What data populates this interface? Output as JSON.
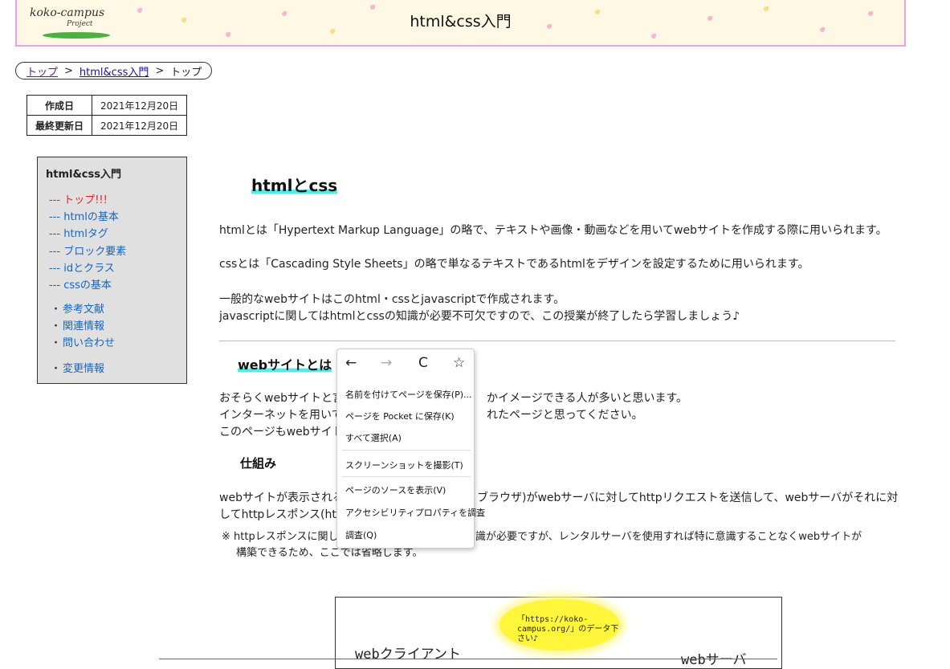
{
  "header": {
    "logo_line1": "koko-campus",
    "logo_line2": "Project",
    "title": "html&css入門"
  },
  "breadcrumb": {
    "items": [
      "トップ",
      "html&css入門",
      "トップ"
    ],
    "separator": ">"
  },
  "dates": {
    "created_label": "作成日",
    "created_value": "2021年12月20日",
    "updated_label": "最終更新日",
    "updated_value": "2021年12月20日"
  },
  "sidebar": {
    "title": "html&css入門",
    "sub_items": [
      "--- トップ!!!",
      "--- htmlの基本",
      "--- htmlタグ",
      "--- ブロック要素",
      "--- idとクラス",
      "--- cssの基本"
    ],
    "links": [
      "参考文献",
      "関連情報",
      "問い合わせ",
      "変更情報"
    ]
  },
  "content": {
    "h2": "htmlとcss",
    "p1": "htmlとは「Hypertext Markup Language」の略で、テキストや画像・動画などを用いてwebサイトを作成する際に用いられます。",
    "p2": "cssとは「Cascading Style Sheets」の略で単なるテキストであるhtmlをデザインを設定するために用いられます。",
    "p3a": "一般的なwebサイトはこのhtml・cssとjavascriptで作成されます。",
    "p3b": "javascriptに関してはhtmlとcssの知識が必要不可欠ですので、この授業が終了したら学習しましょう♪",
    "h3": "webサイトとは",
    "p4a_left": "おそらくwebサイトと言",
    "p4a_right": "かイメージできる人が多いと思います。",
    "p4b_left": "インターネットを用いて",
    "p4b_right": "れたページと思ってください。",
    "p4c_left": "このページもwebサイト",
    "h4": "仕組み",
    "p5a_left": "webサイトが表示される",
    "p5a_right": "ブラウザ)がwebサーバに対してhttpリクエストを送信して、webサーバがそれに対",
    "p5b_left": "してhttpレスポンス(ht",
    "note_a_left": "※ httpレスポンスに関し",
    "note_a_right": "識が必要ですが、レンタルサーバを使用すれば特に意識することなくwebサイトが",
    "note_b": "構築できるため、ここでは省略します。"
  },
  "diagram": {
    "client_label": "webクライアント",
    "server_label": "webサーバ",
    "bubble_text": "「https://koko-campus.org/」のデータ下さい♪"
  },
  "context_menu": {
    "nav": {
      "back": "←",
      "forward": "→",
      "reload": "C",
      "bookmark": "☆"
    },
    "items": [
      "名前を付けてページを保存(P)...",
      "ページを Pocket に保存(K)",
      "すべて選択(A)",
      "スクリーンショットを撮影(T)",
      "ページのソースを表示(V)",
      "アクセシビリティプロパティを調査",
      "調査(Q)"
    ]
  }
}
